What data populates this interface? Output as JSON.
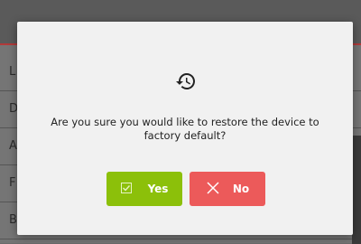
{
  "background": {
    "rows": [
      {
        "letter": "L"
      },
      {
        "letter": "D"
      },
      {
        "letter": "A"
      },
      {
        "letter": "F"
      },
      {
        "letter": "B"
      }
    ]
  },
  "dialog": {
    "icon": "restore-history-icon",
    "message": "Are you sure you would like to restore the device to factory default?",
    "yes_label": "Yes",
    "no_label": "No",
    "colors": {
      "yes": "#8cc00a",
      "no": "#ec5a5a"
    }
  }
}
